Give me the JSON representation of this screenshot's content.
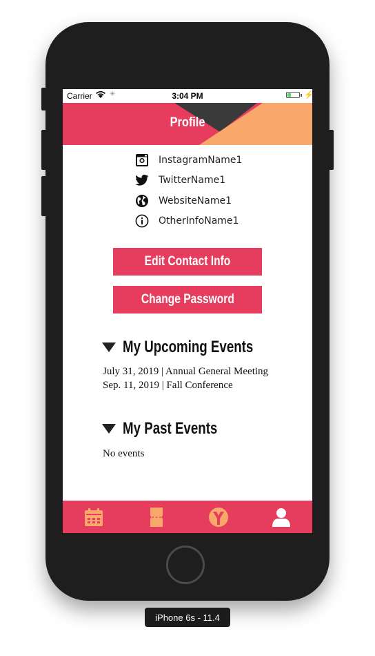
{
  "status_bar": {
    "carrier": "Carrier",
    "time": "3:04 PM"
  },
  "header": {
    "title": "Profile",
    "colors": {
      "primary": "#e63d5e",
      "dark": "#3a3a3a",
      "accent": "#f7a86a"
    }
  },
  "social": [
    {
      "icon": "instagram-icon",
      "label": "InstagramName1"
    },
    {
      "icon": "twitter-icon",
      "label": "TwitterName1"
    },
    {
      "icon": "globe-icon",
      "label": "WebsiteName1"
    },
    {
      "icon": "info-icon",
      "label": "OtherInfoName1"
    }
  ],
  "buttons": {
    "edit_contact": "Edit Contact Info",
    "change_password": "Change Password"
  },
  "upcoming": {
    "title": "My Upcoming Events",
    "events": [
      "July 31, 2019 | Annual General Meeting",
      "Sep. 11, 2019 | Fall Conference"
    ]
  },
  "past": {
    "title": "My Past Events",
    "empty_text": "No events"
  },
  "tabbar": {
    "tabs": [
      {
        "icon": "calendar-icon"
      },
      {
        "icon": "ticket-icon"
      },
      {
        "icon": "logo-y-icon"
      },
      {
        "icon": "profile-icon",
        "active": true
      }
    ],
    "icon_color": "#f7a86a"
  },
  "device_label": "iPhone 6s - 11.4"
}
